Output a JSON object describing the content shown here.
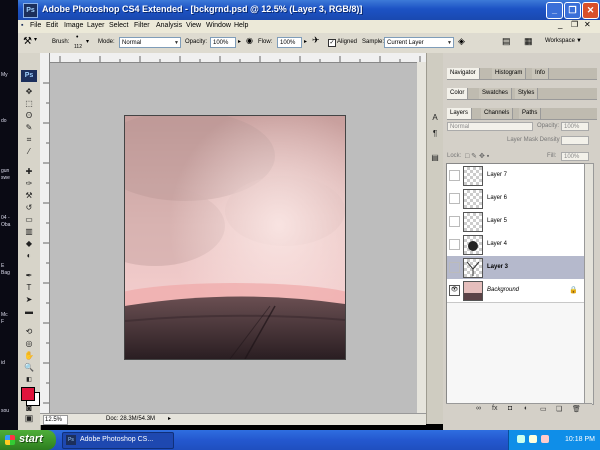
{
  "window": {
    "title": "Adobe Photoshop CS4 Extended - [bckgrnd.psd @ 12.5% (Layer 3, RGB/8)]",
    "app_icon": "Ps"
  },
  "desktop": {
    "labels": [
      "My",
      "do",
      "gun",
      "swe",
      "04 -",
      "Oba",
      "E",
      "Bag",
      "Mc",
      "F",
      "id",
      "sou"
    ]
  },
  "menu": [
    "File",
    "Edit",
    "Image",
    "Layer",
    "Select",
    "Filter",
    "Analysis",
    "View",
    "Window",
    "Help"
  ],
  "options": {
    "brush_label": "Brush:",
    "brush_size": "112",
    "mode_label": "Mode:",
    "mode_value": "Normal",
    "opacity_label": "Opacity:",
    "opacity_value": "100%",
    "flow_label": "Flow:",
    "flow_value": "100%",
    "aligned_label": "Aligned",
    "aligned_checked": true,
    "sample_label": "Sample:",
    "sample_value": "Current Layer",
    "workspace_label": "Workspace"
  },
  "toolbox": {
    "logo": "Ps",
    "tools": [
      "move-tool-icon",
      "marquee-tool-icon",
      "lasso-tool-icon",
      "quick-select-tool-icon",
      "crop-tool-icon",
      "eyedropper-tool-icon",
      "healing-brush-tool-icon",
      "brush-tool-icon",
      "clone-stamp-tool-icon",
      "history-brush-tool-icon",
      "eraser-tool-icon",
      "gradient-tool-icon",
      "blur-tool-icon",
      "dodge-tool-icon",
      "pen-tool-icon",
      "type-tool-icon",
      "path-select-tool-icon",
      "shape-tool-icon",
      "3d-rotate-tool-icon",
      "3d-orbit-tool-icon",
      "hand-tool-icon",
      "zoom-tool-icon"
    ],
    "foreground_color": "#e0143c",
    "background_color": "#ffffff"
  },
  "document": {
    "zoom": "12.5%",
    "doc_size": "Doc: 28.3M/54.3M"
  },
  "panels": {
    "group1_tabs": [
      "Navigator",
      "Histogram",
      "Info"
    ],
    "group2_tabs": [
      "Color",
      "Swatches",
      "Styles"
    ],
    "group3_tabs": [
      "Layers",
      "Channels",
      "Paths"
    ],
    "blend_mode": "Normal",
    "opacity_label": "Opacity:",
    "opacity_value": "100%",
    "mask_density_label": "Layer Mask Density",
    "lock_label": "Lock:",
    "fill_label": "Fill:",
    "fill_value": "100%"
  },
  "layers": [
    {
      "name": "Layer 7",
      "selected": false,
      "visible": false
    },
    {
      "name": "Layer 6",
      "selected": false,
      "visible": false
    },
    {
      "name": "Layer 5",
      "selected": false,
      "visible": false
    },
    {
      "name": "Layer 4",
      "selected": false,
      "visible": false
    },
    {
      "name": "Layer 3",
      "selected": true,
      "visible": false
    },
    {
      "name": "Background",
      "selected": false,
      "visible": true
    }
  ],
  "taskbar": {
    "start_label": "start",
    "task_item": "Adobe Photoshop CS...",
    "clock": "10:18 PM"
  }
}
